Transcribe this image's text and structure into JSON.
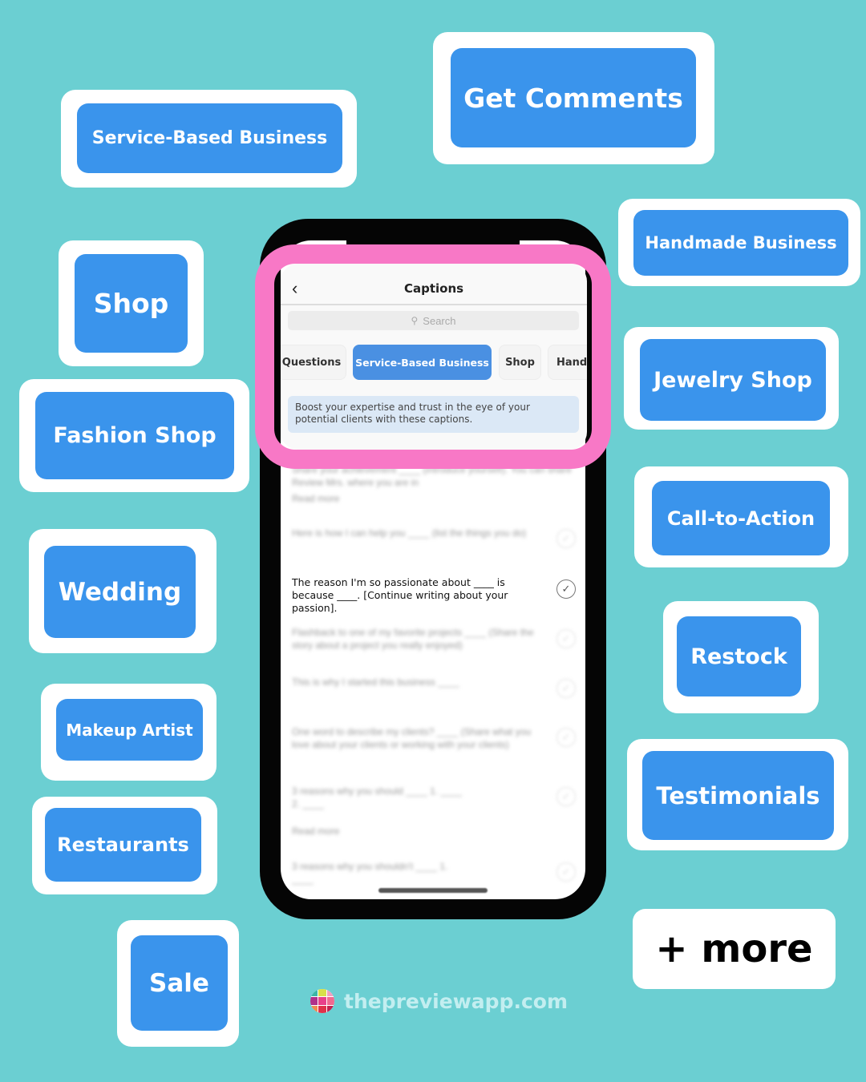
{
  "tags": [
    {
      "label": "Get Comments",
      "name": "tag-get-comments"
    },
    {
      "label": "Service-Based Business",
      "name": "tag-service-based-business"
    },
    {
      "label": "Handmade Business",
      "name": "tag-handmade-business"
    },
    {
      "label": "Shop",
      "name": "tag-shop"
    },
    {
      "label": "Jewelry Shop",
      "name": "tag-jewelry-shop"
    },
    {
      "label": "Fashion Shop",
      "name": "tag-fashion-shop"
    },
    {
      "label": "Call-to-Action",
      "name": "tag-call-to-action"
    },
    {
      "label": "Wedding",
      "name": "tag-wedding"
    },
    {
      "label": "Restock",
      "name": "tag-restock"
    },
    {
      "label": "Makeup Artist",
      "name": "tag-makeup-artist"
    },
    {
      "label": "Testimonials",
      "name": "tag-testimonials"
    },
    {
      "label": "Restaurants",
      "name": "tag-restaurants"
    },
    {
      "label": "Sale",
      "name": "tag-sale"
    }
  ],
  "more_label": "+ more",
  "app": {
    "title": "Captions",
    "back_icon": "chevron-left-icon",
    "search_placeholder": "Search",
    "chips": [
      "Questions",
      "Service-Based Business",
      "Shop",
      "Hand"
    ],
    "active_chip": "Service-Based Business",
    "description": "Boost your expertise and trust in the eye of your potential clients with these captions.",
    "captions": [
      {
        "text": "The reason I'm so passionate about ____ is because ____. [Continue writing about your passion].",
        "blurred": false
      }
    ],
    "blurred_captions": [
      "Share your achievement ____ (introduce yourself). You can share Review Mrs. where you are in",
      "Read more",
      "Here is how I can help you ____ (list the things you do)",
      "Flashback to one of my favorite projects ____ (Share the story about a project you really enjoyed)",
      "This is why I started this business ____",
      "One word to describe my clients? ____ (Share what you love about your clients or working with your clients)",
      "3 reasons why you should ____ 1. ____ 2. ____",
      "Read more",
      "3 reasons why you shouldn't ____ 1. ____"
    ]
  },
  "footer": {
    "brand": "thepreviewapp.com"
  },
  "colors": {
    "background": "#6bcfd2",
    "tag_blue": "#3a94ec",
    "highlight_pink": "#f878c6"
  }
}
